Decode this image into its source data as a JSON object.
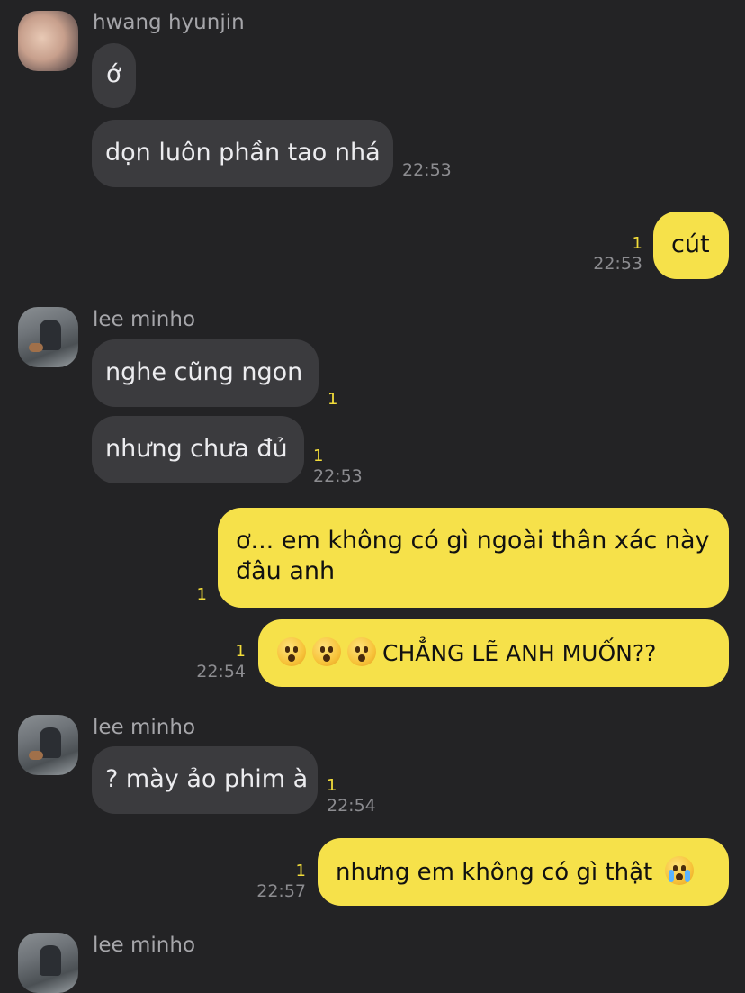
{
  "chat": {
    "groups": [
      {
        "sender": "hwang hyunjin",
        "avatar_icon": "profile-photo-face"
      },
      {
        "sender": "lee minho",
        "avatar_icon": "profile-photo-person-with-dog"
      },
      {
        "sender": "lee minho",
        "avatar_icon": "profile-photo-person-with-dog"
      },
      {
        "sender": "lee minho",
        "avatar_icon": "profile-photo-person-with-dog"
      }
    ],
    "messages": [
      {
        "text": "ớ",
        "from": "hwang hyunjin"
      },
      {
        "text": "dọn luôn phần tao nhá",
        "from": "hwang hyunjin",
        "time": "22:53"
      },
      {
        "text": "cút",
        "from": "me",
        "unread": "1",
        "time": "22:53"
      },
      {
        "text": "nghe cũng ngon",
        "from": "lee minho",
        "unread": "1"
      },
      {
        "text": "nhưng chưa đủ",
        "from": "lee minho",
        "unread": "1",
        "time": "22:53"
      },
      {
        "line1": "ơ... em không có gì ngoài thân xác này",
        "line2": "đâu anh",
        "from": "me",
        "unread": "1"
      },
      {
        "text": "CHẲNG LẼ ANH MUỐN??",
        "emoji": "astonished-face x3",
        "from": "me",
        "unread": "1",
        "time": "22:54"
      },
      {
        "text": "? mày ảo phim à",
        "from": "lee minho",
        "unread": "1",
        "time": "22:54"
      },
      {
        "text": "nhưng em không có gì thật",
        "emoji": "loudly-crying-face",
        "from": "me",
        "unread": "1",
        "time": "22:57"
      }
    ]
  },
  "colors": {
    "background": "#232325",
    "incoming_bubble": "#3b3b3e",
    "outgoing_bubble": "#f6e14a",
    "unread_count": "#f3dd3a",
    "timestamp": "#8c8c90"
  }
}
